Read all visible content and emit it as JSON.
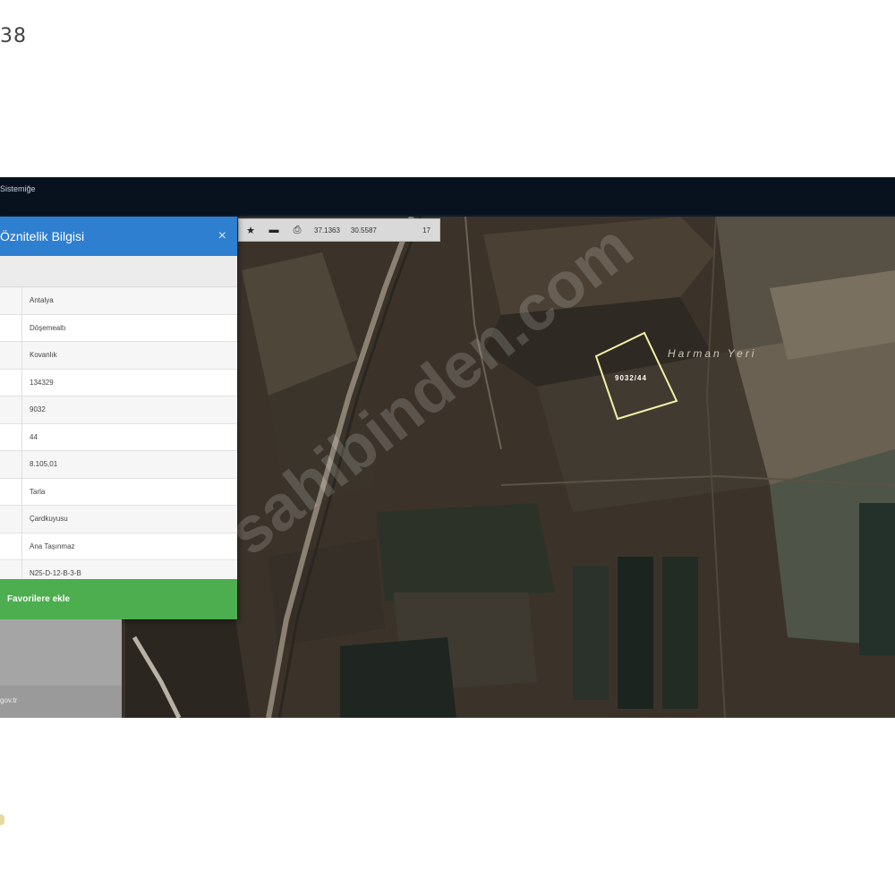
{
  "corner_text": "38",
  "app": {
    "title": "Sistemiğe"
  },
  "toolbar": {
    "coord_x": "37.1363",
    "coord_y": "30.5587",
    "zoom": "17",
    "icons": [
      "star-icon",
      "minus-icon",
      "print-icon"
    ]
  },
  "map": {
    "place_label": "Harman Yeri",
    "parcel_label": "9032/44",
    "watermark": "sahibinden.com"
  },
  "panel": {
    "title": "Öznitelik Bilgisi",
    "close_label": "×",
    "rows": [
      {
        "value": "Antalya"
      },
      {
        "value": "Döşemealtı"
      },
      {
        "value": "Kovanlık"
      },
      {
        "value": "134329"
      },
      {
        "value": "9032"
      },
      {
        "value": "44"
      },
      {
        "value": "8.105,01"
      },
      {
        "value": "Tarla"
      },
      {
        "value": "Çardkuyusu"
      },
      {
        "value": "Ana Taşınmaz"
      },
      {
        "value": "N25-D-12-B-3-B"
      }
    ],
    "favorite_button": "Favorilere ekle"
  },
  "lower_panel": {
    "link_text": "gov.tr"
  }
}
